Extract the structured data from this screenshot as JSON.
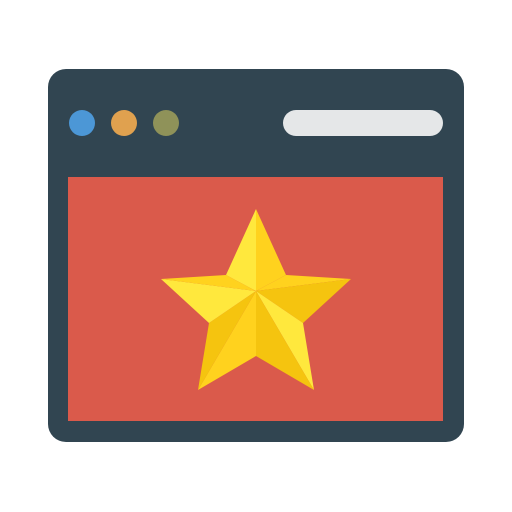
{
  "icon": {
    "name": "browser-window-star-icon",
    "colors": {
      "frame": "#314551",
      "content": "#da5a4b",
      "dot_close": "#4c97d6",
      "dot_minimize": "#e0a14f",
      "dot_maximize": "#8f9259",
      "address_bar": "#e5e7e8",
      "star_light": "#ffe83d",
      "star_mid": "#ffd21e",
      "star_dark": "#f5c40f"
    }
  }
}
